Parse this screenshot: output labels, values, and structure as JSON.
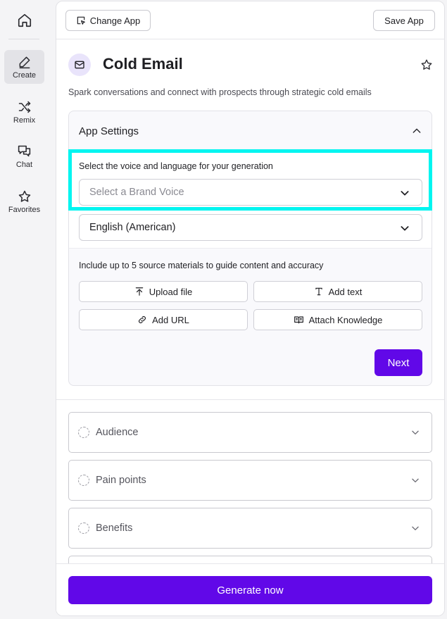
{
  "rail": {
    "items": [
      {
        "label": "Create",
        "icon": "pen-icon",
        "active": true
      },
      {
        "label": "Remix",
        "icon": "shuffle-icon"
      },
      {
        "label": "Chat",
        "icon": "chat-bubbles-icon"
      },
      {
        "label": "Favorites",
        "icon": "star-icon"
      }
    ]
  },
  "toolbar": {
    "change_app_label": "Change App",
    "save_app_label": "Save App"
  },
  "app": {
    "title": "Cold Email",
    "description": "Spark conversations and connect with prospects through strategic cold emails"
  },
  "settings": {
    "title": "App Settings",
    "voice_label": "Select the voice and language for your generation",
    "brand_voice_placeholder": "Select a Brand Voice",
    "language_value": "English (American)",
    "sources_label": "Include up to 5 source materials to guide content and accuracy",
    "source_buttons": {
      "upload": "Upload file",
      "text": "Add text",
      "url": "Add URL",
      "knowledge": "Attach Knowledge"
    },
    "next_label": "Next"
  },
  "sections": [
    {
      "label": "Audience"
    },
    {
      "label": "Pain points"
    },
    {
      "label": "Benefits"
    }
  ],
  "generate_label": "Generate now",
  "colors": {
    "accent": "#6108e8",
    "highlight": "#00f5f0",
    "icon_bg": "#e9e4fb"
  }
}
